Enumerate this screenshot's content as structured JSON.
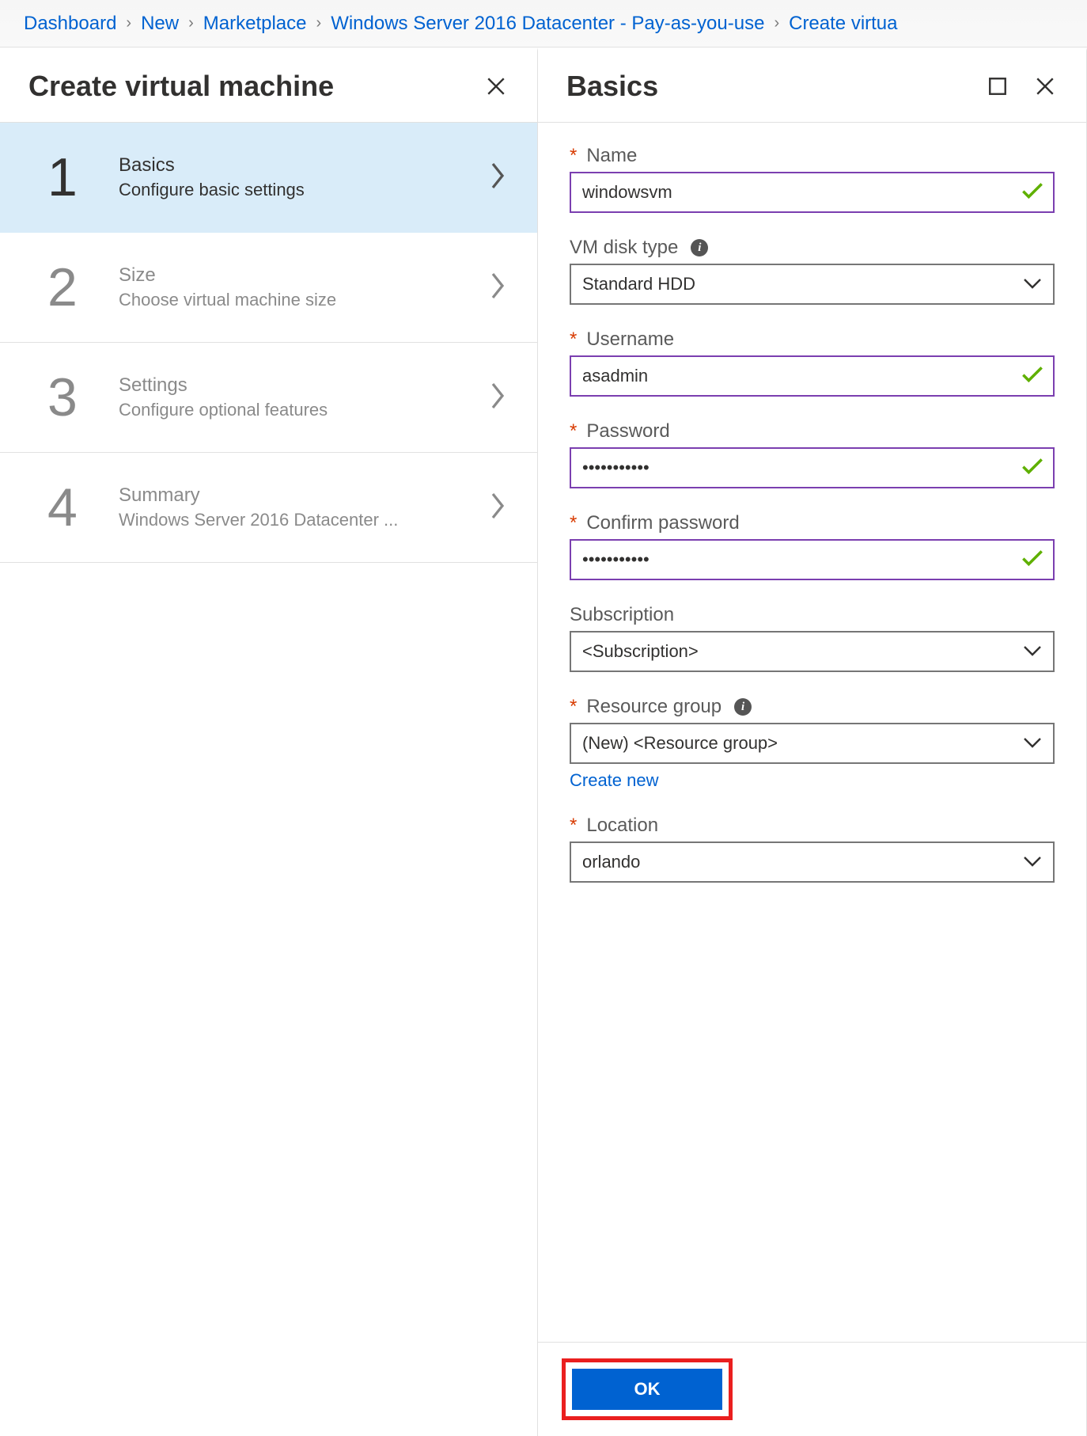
{
  "breadcrumb": [
    "Dashboard",
    "New",
    "Marketplace",
    "Windows Server 2016 Datacenter - Pay-as-you-use",
    "Create virtua"
  ],
  "left_blade": {
    "title": "Create virtual machine",
    "steps": [
      {
        "num": "1",
        "title": "Basics",
        "subtitle": "Configure basic settings",
        "active": true
      },
      {
        "num": "2",
        "title": "Size",
        "subtitle": "Choose virtual machine size",
        "active": false
      },
      {
        "num": "3",
        "title": "Settings",
        "subtitle": "Configure optional features",
        "active": false
      },
      {
        "num": "4",
        "title": "Summary",
        "subtitle": "Windows Server 2016 Datacenter ...",
        "active": false
      }
    ]
  },
  "right_blade": {
    "title": "Basics",
    "fields": {
      "name": {
        "label": "Name",
        "value": "windowsvm",
        "required": true,
        "valid": true
      },
      "disk_type": {
        "label": "VM disk type",
        "value": "Standard HDD",
        "required": false,
        "info": true
      },
      "username": {
        "label": "Username",
        "value": "asadmin",
        "required": true,
        "valid": true
      },
      "password": {
        "label": "Password",
        "value": "•••••••••••",
        "required": true,
        "valid": true
      },
      "confirm_password": {
        "label": "Confirm password",
        "value": "•••••••••••",
        "required": true,
        "valid": true
      },
      "subscription": {
        "label": "Subscription",
        "value": "<Subscription>",
        "required": false
      },
      "resource_group": {
        "label": "Resource group",
        "value": "(New)  <Resource group>",
        "required": true,
        "info": true,
        "link": "Create new"
      },
      "location": {
        "label": "Location",
        "value": "orlando",
        "required": true
      }
    },
    "ok_label": "OK"
  }
}
